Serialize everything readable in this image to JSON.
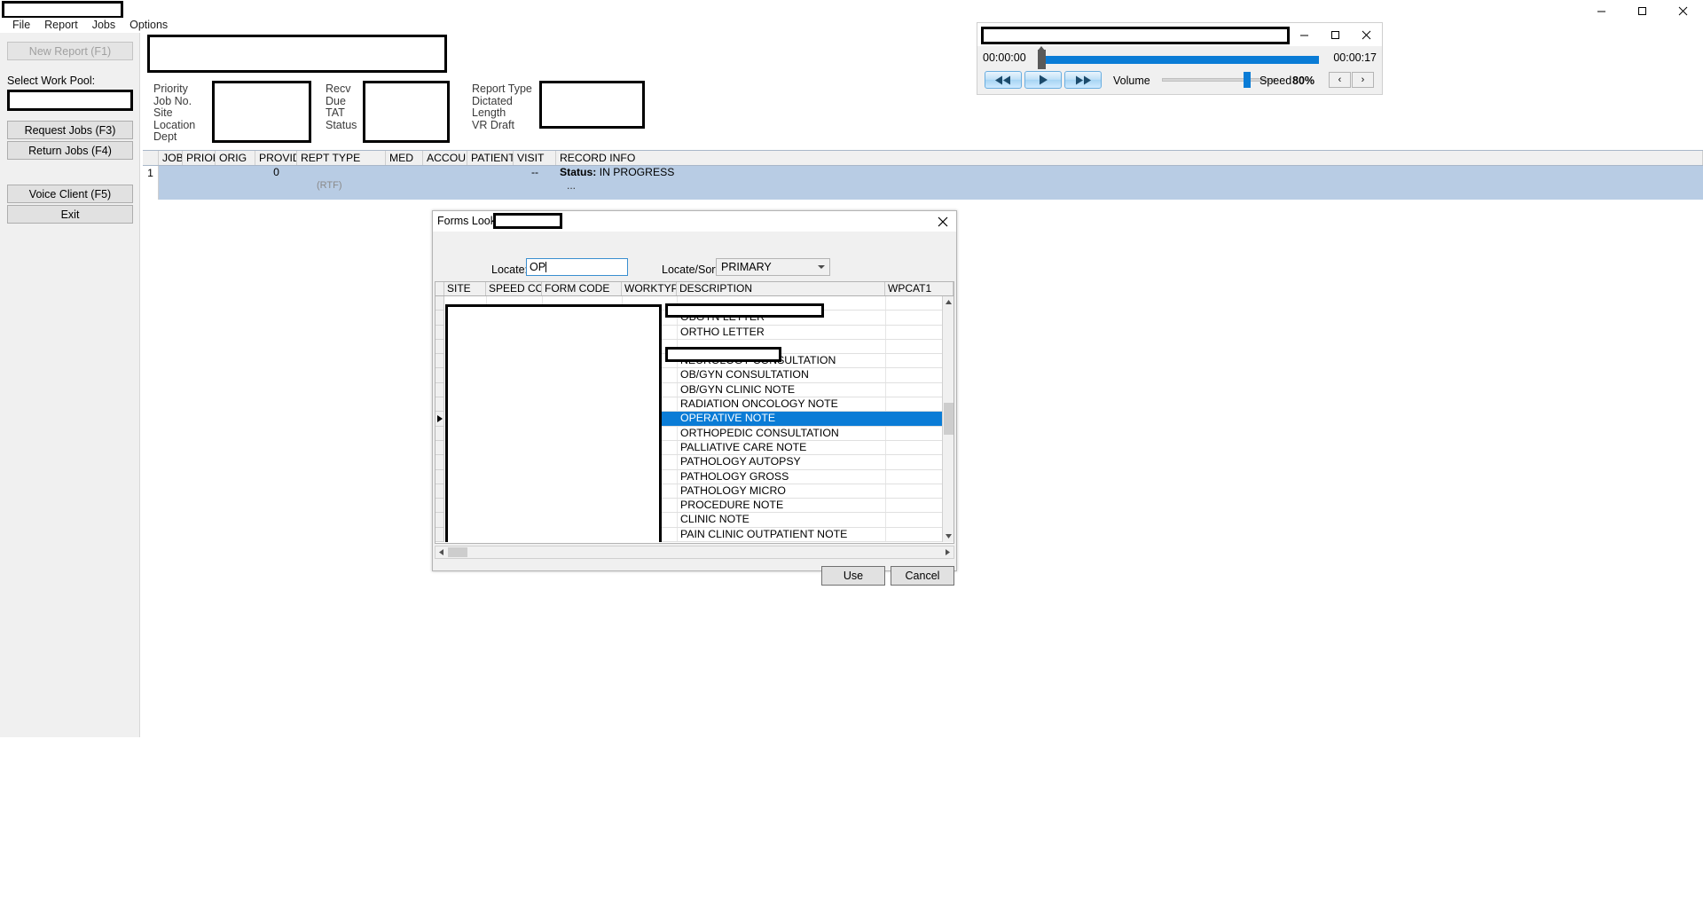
{
  "window": {
    "title_redacted": true,
    "controls": {
      "minimize": "minimize-icon",
      "maximize": "maximize-icon",
      "close": "close-icon"
    }
  },
  "menubar": {
    "items": [
      "File",
      "Report",
      "Jobs",
      "Options"
    ]
  },
  "sidebar": {
    "new_report_button": "New Report (F1)",
    "work_pool_label": "Select Work Pool:",
    "work_pool_value": "",
    "request_jobs_button": "Request Jobs (F3)",
    "return_jobs_button": "Return Jobs (F4)",
    "voice_client_button": "Voice Client (F5)",
    "exit_button": "Exit"
  },
  "details": {
    "col1": [
      "Priority",
      "Job No.",
      "Site",
      "Location",
      "Dept"
    ],
    "col2": [
      "Recv",
      "Due",
      "TAT",
      "Status"
    ],
    "col3": [
      "Report Type",
      "Dictated",
      "Length",
      "VR Draft"
    ]
  },
  "jobs_grid": {
    "columns": [
      "JOB",
      "PRIORI",
      "ORIG",
      "PROVID",
      "REPT TYPE",
      "MED",
      "ACCOU",
      "PATIENT",
      "VISIT",
      "RECORD INFO"
    ],
    "rows": [
      {
        "num": "1",
        "job": "",
        "priority": "",
        "orig": "",
        "provid": "0",
        "rept_type": "",
        "rept_type_sub": "(RTF)",
        "med": "",
        "accou": "",
        "patient": "",
        "visit": "--",
        "record_info_label": "Status:",
        "record_info_value": "IN PROGRESS",
        "record_info_sub": "..."
      }
    ]
  },
  "player": {
    "elapsed": "00:00:00",
    "total": "00:00:17",
    "rewind_button": "rewind-icon",
    "play_button": "play-icon",
    "forward_button": "fast-forward-icon",
    "volume_label": "Volume",
    "speed_label": "Speed",
    "speed_value": "80%",
    "speed_down": "‹",
    "speed_up": "›",
    "progress_percent": 0,
    "volume_percent": 72,
    "accent_color": "#0a7cd6"
  },
  "dialog": {
    "title": "Forms Lookup",
    "close_icon": "close-icon",
    "locate_label": "Locate:",
    "locate_value": "OP",
    "sort_label": "Locate/Sort by:",
    "sort_value": "PRIMARY",
    "grid_columns": [
      "SITE",
      "SPEED CODE",
      "FORM CODE",
      "WORKTYPE",
      "DESCRIPTION",
      "WPCAT1"
    ],
    "rows": [
      {
        "site": "",
        "speed_code": "",
        "form_code": "",
        "worktype": "",
        "description": "",
        "wpcat1": "",
        "redacted": true,
        "selected": false
      },
      {
        "site": "",
        "speed_code": "",
        "form_code": "",
        "worktype": "",
        "description": "OBGYN LETTER",
        "wpcat1": "",
        "redacted": false,
        "selected": false
      },
      {
        "site": "",
        "speed_code": "",
        "form_code": "",
        "worktype": "",
        "description": "ORTHO LETTER",
        "wpcat1": "",
        "redacted": false,
        "selected": false
      },
      {
        "site": "",
        "speed_code": "",
        "form_code": "",
        "worktype": "",
        "description": "",
        "wpcat1": "",
        "redacted": true,
        "selected": false
      },
      {
        "site": "",
        "speed_code": "",
        "form_code": "",
        "worktype": "",
        "description": "NEUROLOGY CONSULTATION",
        "wpcat1": "",
        "redacted": false,
        "selected": false
      },
      {
        "site": "",
        "speed_code": "",
        "form_code": "",
        "worktype": "",
        "description": "OB/GYN CONSULTATION",
        "wpcat1": "",
        "redacted": false,
        "selected": false
      },
      {
        "site": "",
        "speed_code": "",
        "form_code": "",
        "worktype": "",
        "description": "OB/GYN CLINIC NOTE",
        "wpcat1": "",
        "redacted": false,
        "selected": false
      },
      {
        "site": "",
        "speed_code": "",
        "form_code": "",
        "worktype": "",
        "description": "RADIATION ONCOLOGY NOTE",
        "wpcat1": "",
        "redacted": false,
        "selected": false
      },
      {
        "site": "",
        "speed_code": "",
        "form_code": "",
        "worktype": "",
        "description": "OPERATIVE NOTE",
        "wpcat1": "",
        "redacted": false,
        "selected": true
      },
      {
        "site": "",
        "speed_code": "",
        "form_code": "",
        "worktype": "",
        "description": "ORTHOPEDIC CONSULTATION",
        "wpcat1": "",
        "redacted": false,
        "selected": false
      },
      {
        "site": "",
        "speed_code": "",
        "form_code": "",
        "worktype": "",
        "description": "PALLIATIVE CARE NOTE",
        "wpcat1": "",
        "redacted": false,
        "selected": false
      },
      {
        "site": "",
        "speed_code": "",
        "form_code": "",
        "worktype": "",
        "description": "PATHOLOGY AUTOPSY",
        "wpcat1": "",
        "redacted": false,
        "selected": false
      },
      {
        "site": "",
        "speed_code": "",
        "form_code": "",
        "worktype": "",
        "description": "PATHOLOGY GROSS",
        "wpcat1": "",
        "redacted": false,
        "selected": false
      },
      {
        "site": "",
        "speed_code": "",
        "form_code": "",
        "worktype": "",
        "description": "PATHOLOGY MICRO",
        "wpcat1": "",
        "redacted": false,
        "selected": false
      },
      {
        "site": "",
        "speed_code": "",
        "form_code": "",
        "worktype": "",
        "description": "PROCEDURE NOTE",
        "wpcat1": "",
        "redacted": false,
        "selected": false
      },
      {
        "site": "",
        "speed_code": "",
        "form_code": "",
        "worktype": "",
        "description": "CLINIC NOTE",
        "wpcat1": "",
        "redacted": false,
        "selected": false
      },
      {
        "site": "",
        "speed_code": "",
        "form_code": "",
        "worktype": "",
        "description": "PAIN CLINIC OUTPATIENT NOTE",
        "wpcat1": "",
        "redacted": false,
        "selected": false
      }
    ],
    "use_button": "Use",
    "cancel_button": "Cancel",
    "selection_color": "#0a7cd6"
  }
}
